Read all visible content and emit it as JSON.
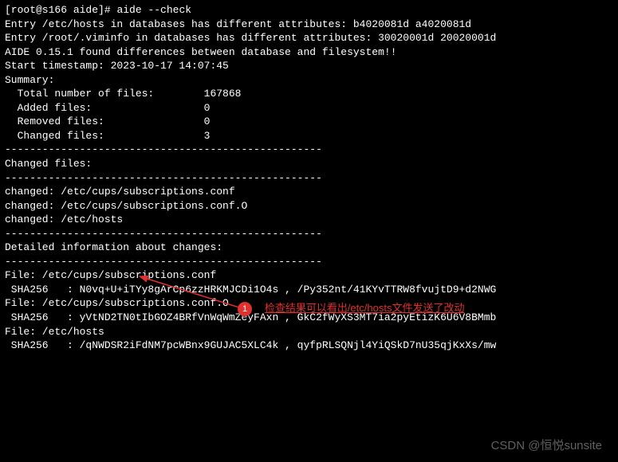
{
  "prompt": "[root@s166 aide]# ",
  "command": "aide --check",
  "output": {
    "entry1": "Entry /etc/hosts in databases has different attributes: b4020081d a4020081d",
    "entry2": "Entry /root/.viminfo in databases has different attributes: 30020001d 20020001d",
    "diffline": "AIDE 0.15.1 found differences between database and filesystem!!",
    "start": "Start timestamp: 2023-10-17 14:07:45",
    "blank": "",
    "summary_hdr": "Summary:",
    "total": "  Total number of files:        167868",
    "added": "  Added files:                  0",
    "removed": "  Removed files:                0",
    "changed": "  Changed files:                3",
    "sep": "---------------------------------------------------",
    "changed_hdr": "Changed files:",
    "cf1": "changed: /etc/cups/subscriptions.conf",
    "cf2": "changed: /etc/cups/subscriptions.conf.O",
    "cf3": "changed: /etc/hosts",
    "det_hdr": "Detailed information about changes:",
    "f1_hdr": "File: /etc/cups/subscriptions.conf",
    "f1_sha": " SHA256   : N0vq+U+iTYy8gArCp6zzHRKMJCDi1O4s , /Py352nt/41KYvTTRW8fvujtD9+d2NWG",
    "f2_hdr": "File: /etc/cups/subscriptions.conf.O",
    "f2_sha": " SHA256   : yVtND2TN0tIbGOZ4BRfVnWqWmZeyFAxn , GkC2fWyXS3MT7ia2pyEtizK6U6V8BMmb",
    "f3_hdr": "File: /etc/hosts",
    "f3_sha": " SHA256   : /qNWDSR2iFdNM7pcWBnx9GUJAC5XLC4k , qyfpRLSQNjl4YiQSkD7nU35qjKxXs/mw"
  },
  "callout": {
    "badge": "1",
    "text": "检查结果可以看出/etc/hosts文件发送了改动"
  },
  "watermark": "CSDN @恒悦sunsite"
}
